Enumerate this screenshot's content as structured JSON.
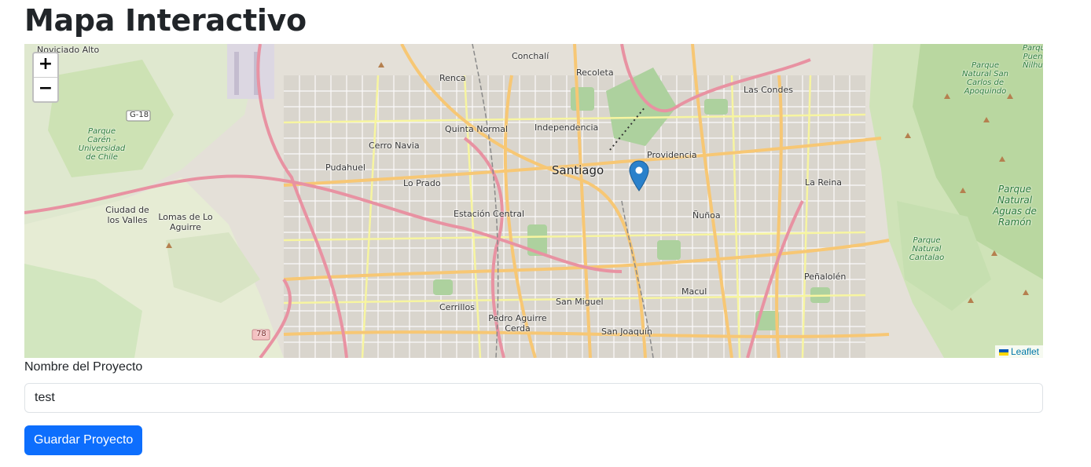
{
  "page": {
    "title": "Mapa Interactivo"
  },
  "map": {
    "zoom_in_label": "+",
    "zoom_out_label": "−",
    "attribution": "Leaflet",
    "places": {
      "noviciado": "Noviciado Alto",
      "conchali": "Conchalí",
      "recoleta": "Recoleta",
      "renca": "Renca",
      "lascondes": "Las Condes",
      "quinta": "Quinta Normal",
      "independencia": "Independencia",
      "cerronavia": "Cerro Navia",
      "pudahuel": "Pudahuel",
      "providencia": "Providencia",
      "santiago": "Santiago",
      "loprado": "Lo Prado",
      "lareina": "La Reina",
      "estacion": "Estación Central",
      "nunoa": "Ñuñoa",
      "ciudadvalles": "Ciudad de los Valles",
      "lomas": "Lomas de Lo Aguirre",
      "penalolen": "Peñalolén",
      "macul": "Macul",
      "cerrillos": "Cerrillos",
      "sanmiguel": "San Miguel",
      "pedroaguirre": "Pedro Aguirre Cerda",
      "sanjoaquin": "San Joaquín",
      "parquecaren": "Parque Carén - Universidad de Chile",
      "parquenatural": "Parque Natural San Carlos de Apoquindo",
      "aguasramon": "Parque Natural Aguas de Ramón",
      "cantalao": "Parque Natural Cantalao",
      "parquepuente": "Parque Puen Ñilhu",
      "g18": "G-18",
      "r78": "78"
    }
  },
  "form": {
    "project_name_label": "Nombre del Proyecto",
    "project_name_value": "test",
    "save_button": "Guardar Proyecto"
  },
  "colors": {
    "primary": "#0d6efd",
    "marker": "#2a81cb",
    "road_major": "#f7c774",
    "road_highway": "#e892a2",
    "park": "#add19e"
  }
}
